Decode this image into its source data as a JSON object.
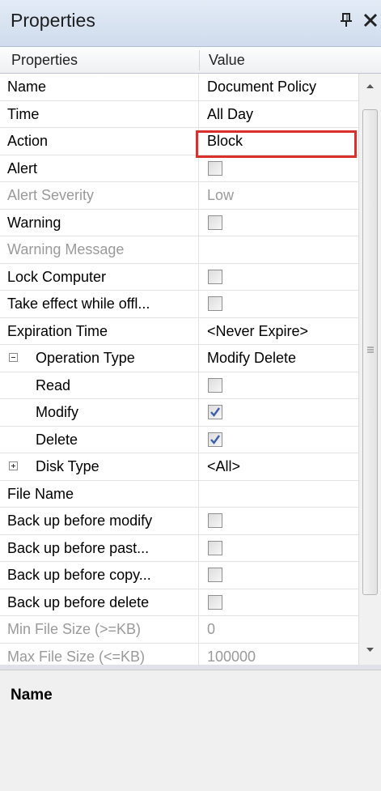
{
  "window": {
    "title": "Properties"
  },
  "grid": {
    "header": {
      "property": "Properties",
      "value": "Value"
    },
    "rows": [
      {
        "name": "Name",
        "value": "Document Policy",
        "kind": "text"
      },
      {
        "name": "Time",
        "value": "All Day",
        "kind": "text"
      },
      {
        "name": "Action",
        "value": "Block",
        "kind": "text",
        "highlighted": true
      },
      {
        "name": "Alert",
        "kind": "checkbox",
        "checked": false
      },
      {
        "name": "Alert Severity",
        "value": "Low",
        "kind": "text",
        "disabled": true
      },
      {
        "name": "Warning",
        "kind": "checkbox",
        "checked": false
      },
      {
        "name": "Warning Message",
        "value": "",
        "kind": "text",
        "disabled": true
      },
      {
        "name": "Lock Computer",
        "kind": "checkbox",
        "checked": false
      },
      {
        "name": "Take effect while offl...",
        "kind": "checkbox",
        "checked": false
      },
      {
        "name": "Expiration Time",
        "value": "<Never Expire>",
        "kind": "text"
      },
      {
        "name": "Operation Type",
        "value": "Modify Delete",
        "kind": "text",
        "group": "expanded"
      },
      {
        "name": "Read",
        "kind": "checkbox",
        "checked": false,
        "child": true
      },
      {
        "name": "Modify",
        "kind": "checkbox",
        "checked": true,
        "child": true
      },
      {
        "name": "Delete",
        "kind": "checkbox",
        "checked": true,
        "child": true
      },
      {
        "name": "Disk Type",
        "value": "<All>",
        "kind": "text",
        "group": "collapsed"
      },
      {
        "name": "File Name",
        "value": "",
        "kind": "text"
      },
      {
        "name": "Back up before modify",
        "kind": "checkbox",
        "checked": false
      },
      {
        "name": "Back up before past...",
        "kind": "checkbox",
        "checked": false
      },
      {
        "name": "Back up before copy...",
        "kind": "checkbox",
        "checked": false
      },
      {
        "name": "Back up before delete",
        "kind": "checkbox",
        "checked": false
      },
      {
        "name": "Min File Size (>=KB)",
        "value": "0",
        "kind": "text",
        "disabled": true
      },
      {
        "name": "Max File Size (<=KB)",
        "value": "100000",
        "kind": "text",
        "disabled": true
      }
    ]
  },
  "description": {
    "title": "Name"
  },
  "colors": {
    "highlight": "#d9302b",
    "check": "#3a5fa8",
    "titlebar": "#d6e2f1"
  },
  "icons": {
    "pin": "pin-icon",
    "close": "close-icon",
    "expand": "plus-icon",
    "collapse": "minus-icon"
  }
}
